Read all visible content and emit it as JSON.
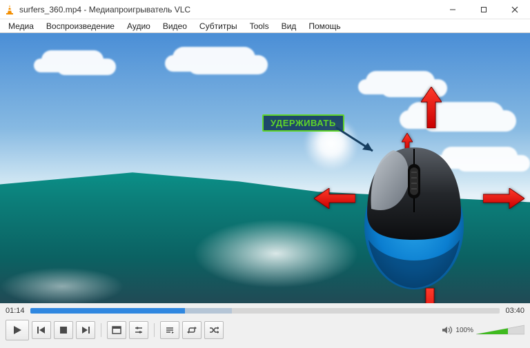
{
  "window": {
    "filename": "surfers_360.mp4",
    "separator": " - ",
    "app_name": "Медиапроигрыватель VLC"
  },
  "menu": {
    "media": "Медиа",
    "playback": "Воспроизведение",
    "audio": "Аудио",
    "video": "Видео",
    "subtitles": "Субтитры",
    "tools": "Tools",
    "view": "Вид",
    "help": "Помощь"
  },
  "annotation": {
    "hold_label": "УДЕРЖИВАТЬ"
  },
  "playback": {
    "current_time": "01:14",
    "total_time": "03:40"
  },
  "volume": {
    "percent_label": "100%"
  },
  "icons": {
    "cone": "vlc-cone",
    "minimize": "minimize",
    "maximize": "maximize",
    "close": "close"
  }
}
